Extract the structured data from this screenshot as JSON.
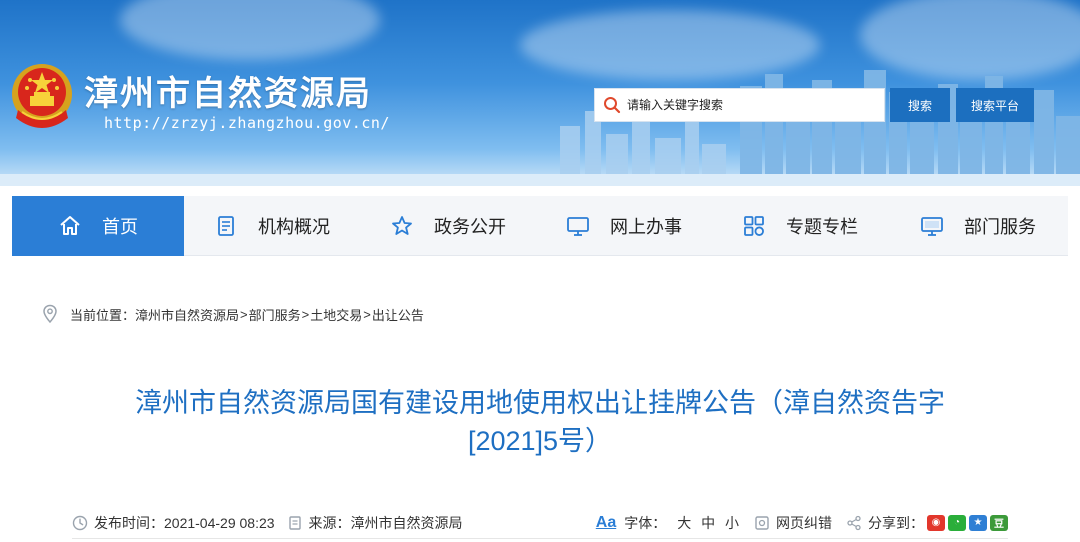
{
  "header": {
    "site_title": "漳州市自然资源局",
    "site_url": "http://zrzyj.zhangzhou.gov.cn/",
    "search": {
      "placeholder": "请输入关键字搜索"
    },
    "search_button": "搜索",
    "platform_button": "搜索平台"
  },
  "nav": {
    "items": [
      {
        "label": "首页",
        "icon": "home-icon",
        "active": true
      },
      {
        "label": "机构概况",
        "icon": "document-icon"
      },
      {
        "label": "政务公开",
        "icon": "star-icon"
      },
      {
        "label": "网上办事",
        "icon": "monitor-icon"
      },
      {
        "label": "专题专栏",
        "icon": "grid-icon"
      },
      {
        "label": "部门服务",
        "icon": "desktop-icon"
      }
    ]
  },
  "breadcrumb": {
    "prefix": "当前位置：",
    "items": [
      "漳州市自然资源局",
      "部门服务",
      "土地交易",
      "出让公告"
    ],
    "separator": ">"
  },
  "article": {
    "title_line1": "漳州市自然资源局国有建设用地使用权出让挂牌公告（漳自然资告字",
    "title_line2": "[2021]5号）"
  },
  "meta": {
    "publish_label": "发布时间：",
    "publish_time": "2021-04-29 08:23",
    "source_label": "来源：",
    "source": "漳州市自然资源局",
    "font_label": "字体：",
    "font_sizes": [
      "大",
      "中",
      "小"
    ],
    "error_label": "网页纠错",
    "share_label": "分享到："
  },
  "colors": {
    "brand_blue": "#2b7ed6",
    "title_blue": "#1e6fc2",
    "button_blue": "#1c6fbf"
  }
}
